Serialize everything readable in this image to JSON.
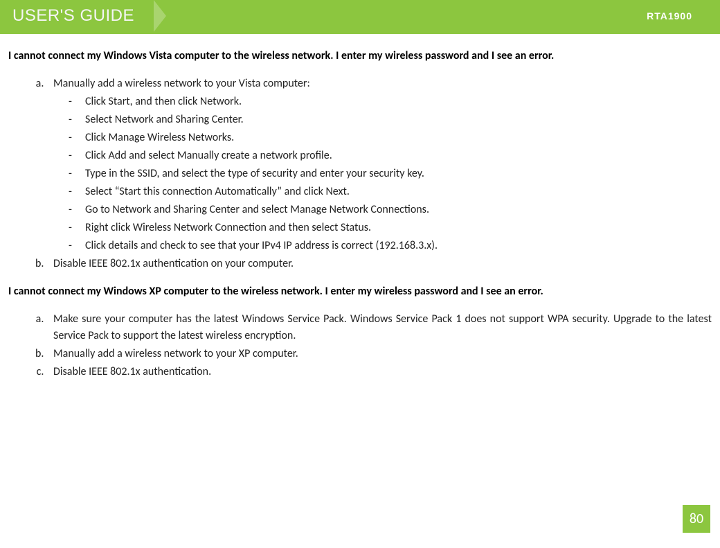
{
  "header": {
    "title": "USER'S GUIDE",
    "model": "RTA1900"
  },
  "section1": {
    "title": "I cannot connect my Windows Vista computer to the wireless network.  I enter my wireless password and I see an error.",
    "a_intro": "Manually add a wireless network to your Vista computer:",
    "a_steps": [
      "Click Start, and then click Network.",
      "Select Network and Sharing Center.",
      "Click Manage Wireless Networks.",
      "Click Add and select Manually create a network profile.",
      "Type in the SSID, and select the type of security and enter your security key.",
      "Select “Start this connection Automatically” and click Next.",
      "Go to Network and Sharing Center and select Manage Network Connections.",
      "Right click Wireless Network Connection and then select Status.",
      "Click details and check to see that your IPv4 IP address is correct (192.168.3.x)."
    ],
    "b": "Disable IEEE 802.1x authentication on your computer."
  },
  "section2": {
    "title": "I cannot connect my Windows XP computer to the wireless network.  I enter my wireless password and I see an error.",
    "a": "Make sure your computer has the latest Windows Service Pack.  Windows Service Pack 1 does not support WPA security.  Upgrade to the latest Service Pack to support the latest wireless encryption.",
    "b": "Manually add a wireless network to your XP computer.",
    "c": "Disable IEEE 802.1x authentication."
  },
  "page_number": "80"
}
